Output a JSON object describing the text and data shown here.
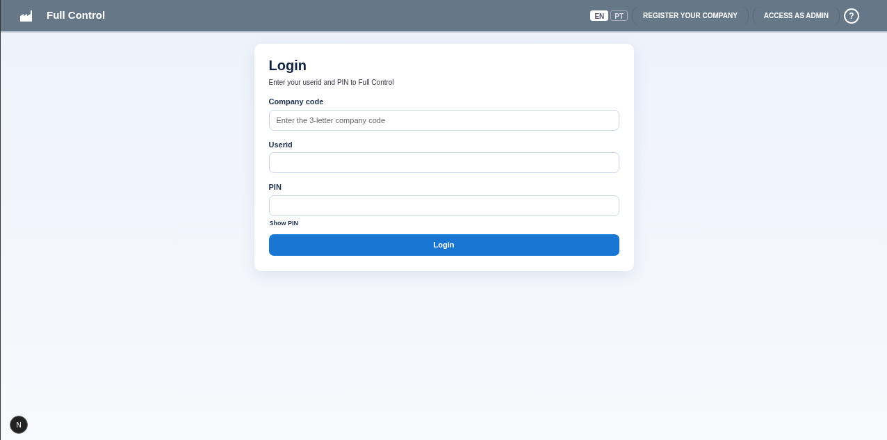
{
  "header": {
    "title": "Full Control",
    "languages": [
      {
        "label": "EN",
        "selected": true
      },
      {
        "label": "PT",
        "selected": false
      }
    ],
    "buttons": [
      "REGISTER YOUR COMPANY",
      "ACCESS AS ADMIN"
    ],
    "help": "?"
  },
  "login": {
    "title": "Login",
    "subtitle": "Enter your userid and PIN to Full Control",
    "fields": [
      {
        "label": "Company code",
        "placeholder": "Enter the 3-letter company code"
      },
      {
        "label": "Userid"
      },
      {
        "label": "PIN"
      }
    ],
    "show_pin": "Show PIN",
    "submit": "Login"
  },
  "dev_badge": "N"
}
